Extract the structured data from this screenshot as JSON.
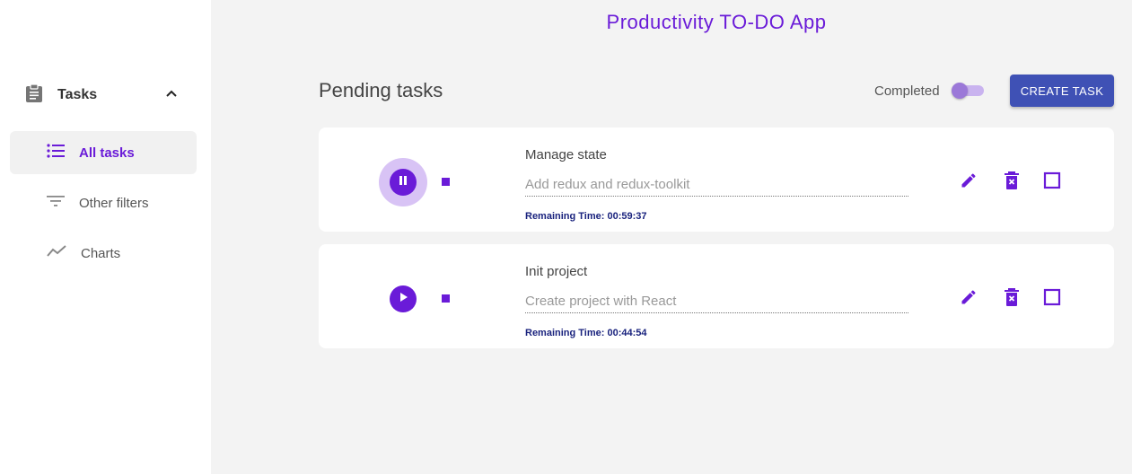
{
  "app": {
    "title": "Productivity TO-DO App"
  },
  "sidebar": {
    "section": {
      "label": "Tasks",
      "icon": "clipboard-icon"
    },
    "items": [
      {
        "label": "All tasks",
        "icon": "list-icon",
        "active": true
      },
      {
        "label": "Other filters",
        "icon": "filter-icon",
        "active": false
      },
      {
        "label": "Charts",
        "icon": "chart-line-icon",
        "active": false
      }
    ]
  },
  "main": {
    "section_title": "Pending tasks",
    "completed_label": "Completed",
    "completed_toggle": false,
    "create_button": "CREATE TASK"
  },
  "tasks": [
    {
      "title": "Manage state",
      "description": "Add redux and redux-toolkit",
      "remaining": "Remaining Time: 00:59:37",
      "state": "playing"
    },
    {
      "title": "Init project",
      "description": "Create project with React",
      "remaining": "Remaining Time: 00:44:54",
      "state": "paused"
    }
  ],
  "colors": {
    "accent": "#6a1bd8",
    "button": "#3f51b5",
    "remaining_text": "#1a237e"
  }
}
